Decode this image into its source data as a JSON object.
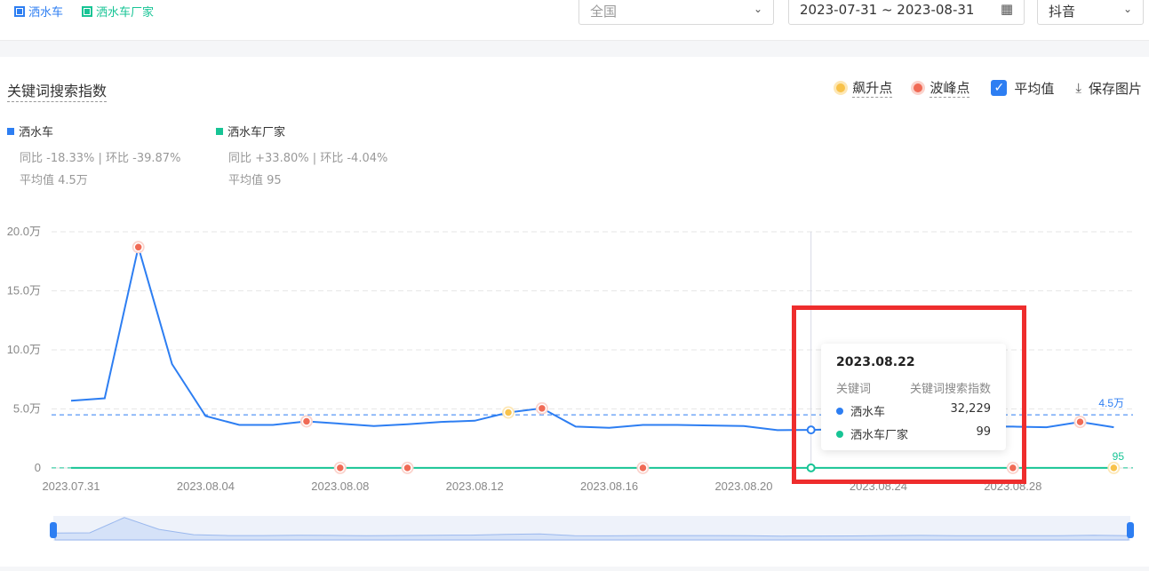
{
  "filters": {
    "keywords": [
      {
        "label": "洒水车",
        "color": "#2d7ef2"
      },
      {
        "label": "洒水车厂家",
        "color": "#17c495"
      }
    ],
    "region": "全国",
    "date_range": "2023-07-31 ~ 2023-08-31",
    "platform": "抖音"
  },
  "panel": {
    "title": "关键词搜索指数",
    "tools": {
      "rise_point": "飙升点",
      "peak_point": "波峰点",
      "average": "平均值",
      "save_image": "保存图片"
    }
  },
  "legend": [
    {
      "name": "洒水车",
      "stat": "同比 -18.33% | 环比 -39.87%",
      "avg": "平均值 4.5万",
      "color": "#2d7ef2"
    },
    {
      "name": "洒水车厂家",
      "stat": "同比 +33.80% | 环比 -4.04%",
      "avg": "平均值 95",
      "color": "#17c495"
    }
  ],
  "tooltip": {
    "date": "2023.08.22",
    "col1": "关键词",
    "col2": "关键词搜索指数",
    "rows": [
      {
        "name": "洒水车",
        "value": "32,229"
      },
      {
        "name": "洒水车厂家",
        "value": "99"
      }
    ]
  },
  "chart_data": {
    "type": "line",
    "x": [
      "2023.07.31",
      "2023.08.01",
      "2023.08.02",
      "2023.08.03",
      "2023.08.04",
      "2023.08.05",
      "2023.08.06",
      "2023.08.07",
      "2023.08.08",
      "2023.08.09",
      "2023.08.10",
      "2023.08.11",
      "2023.08.12",
      "2023.08.13",
      "2023.08.14",
      "2023.08.15",
      "2023.08.16",
      "2023.08.17",
      "2023.08.18",
      "2023.08.19",
      "2023.08.20",
      "2023.08.21",
      "2023.08.22",
      "2023.08.23",
      "2023.08.24",
      "2023.08.25",
      "2023.08.26",
      "2023.08.27",
      "2023.08.28",
      "2023.08.29",
      "2023.08.30",
      "2023.08.31"
    ],
    "xticks": [
      "2023.07.31",
      "2023.08.04",
      "2023.08.08",
      "2023.08.12",
      "2023.08.16",
      "2023.08.20",
      "2023.08.24",
      "2023.08.28"
    ],
    "yticks": [
      "0",
      "5.0万",
      "10.0万",
      "15.0万",
      "20.0万"
    ],
    "ylim": [
      0,
      200000
    ],
    "series": [
      {
        "name": "洒水车",
        "color": "#2d7ef2",
        "values": [
          57000,
          59000,
          187000,
          88000,
          44000,
          36500,
          36500,
          39500,
          37500,
          35500,
          37000,
          39000,
          40000,
          47000,
          50500,
          35000,
          34000,
          36500,
          36500,
          36000,
          35500,
          32000,
          32229,
          33000,
          36000,
          38000,
          35000,
          35000,
          35000,
          34500,
          39000,
          34500
        ],
        "average": 45000,
        "average_label": "4.5万",
        "peaks": [
          "2023.08.02",
          "2023.08.07",
          "2023.08.14",
          "2023.08.30"
        ],
        "rises": [
          "2023.08.13"
        ]
      },
      {
        "name": "洒水车厂家",
        "color": "#17c495",
        "values": [
          95,
          95,
          95,
          95,
          95,
          95,
          95,
          95,
          95,
          95,
          95,
          95,
          95,
          95,
          95,
          95,
          95,
          95,
          95,
          95,
          95,
          95,
          99,
          95,
          95,
          95,
          95,
          95,
          95,
          95,
          95,
          95
        ],
        "average": 95,
        "average_label": "95",
        "peaks": [
          "2023.08.08",
          "2023.08.10",
          "2023.08.17",
          "2023.08.28"
        ],
        "rises": [
          "2023.08.31"
        ]
      }
    ],
    "grid": true,
    "hover_x": "2023.08.22"
  }
}
